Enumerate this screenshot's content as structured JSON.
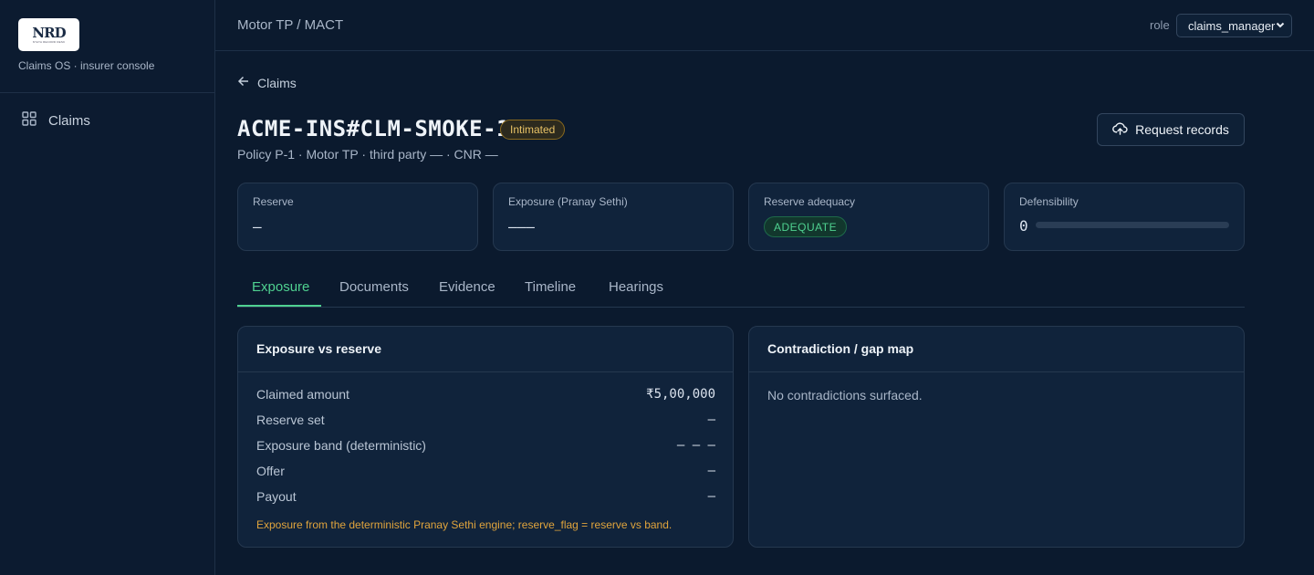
{
  "sidebar": {
    "logo_text": "NRD",
    "logo_tagline": "NYAYA RECORD DESK",
    "subtitle": "Claims OS · insurer console",
    "nav": [
      {
        "label": "Claims",
        "icon": "grid-icon"
      }
    ]
  },
  "topbar": {
    "breadcrumb": "Motor TP / MACT",
    "role_label": "role",
    "role_value": "claims_manager"
  },
  "header": {
    "back_label": "Claims",
    "claim_id": "ACME-INS#CLM-SMOKE-1",
    "status": "Intimated",
    "subtitle": "Policy P-1 · Motor TP · third party — · CNR —",
    "request_button": "Request records"
  },
  "kpis": {
    "reserve": {
      "label": "Reserve",
      "value": "—"
    },
    "exposure": {
      "label": "Exposure (Pranay Sethi)",
      "value": "———"
    },
    "adequacy": {
      "label": "Reserve adequacy",
      "value": "ADEQUATE"
    },
    "defensibility": {
      "label": "Defensibility",
      "value": "0",
      "fraction": 0
    }
  },
  "tabs": [
    {
      "label": "Exposure",
      "active": true
    },
    {
      "label": "Documents",
      "active": false
    },
    {
      "label": "Evidence",
      "active": false
    },
    {
      "label": "Timeline",
      "active": false
    },
    {
      "label": "Hearings",
      "active": false
    }
  ],
  "exposure_panel": {
    "title": "Exposure vs reserve",
    "rows": [
      {
        "label": "Claimed amount",
        "value": "₹5,00,000"
      },
      {
        "label": "Reserve set",
        "value": "—"
      },
      {
        "label": "Exposure band (deterministic)",
        "value": "— – —"
      },
      {
        "label": "Offer",
        "value": "—"
      },
      {
        "label": "Payout",
        "value": "—"
      }
    ],
    "note": "Exposure from the deterministic Pranay Sethi engine; reserve_flag = reserve vs band."
  },
  "contradiction_panel": {
    "title": "Contradiction / gap map",
    "empty_message": "No contradictions surfaced."
  },
  "colors": {
    "accent": "#4fd190",
    "warning": "#e0a43c",
    "badge_text": "#e8c266",
    "background": "#0b1a2e"
  }
}
